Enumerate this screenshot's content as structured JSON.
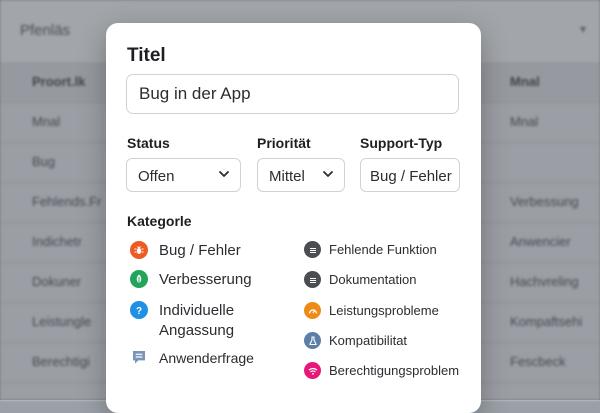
{
  "background": {
    "title": "Pfenläs",
    "header_cells": [
      "Proort.lk",
      "Mnal"
    ],
    "rows": [
      [
        "Mnal",
        "Mnal"
      ],
      [
        "Bug",
        ""
      ],
      [
        "Fehlends.Fr",
        "Verbessung"
      ],
      [
        "Indichetr",
        "Anwencier"
      ],
      [
        "Dokuner",
        "Hachvreling"
      ],
      [
        "Leistungle",
        "Kompaftsehi"
      ],
      [
        "Berechtigi",
        "Fescbeck"
      ]
    ]
  },
  "form": {
    "title_label": "Titel",
    "title_value": "Bug in der App",
    "status": {
      "label": "Status",
      "value": "Offen"
    },
    "priority": {
      "label": "Priorität",
      "value": "Mittel"
    },
    "support_type": {
      "label": "Support-Typ",
      "value": "Bug / Fehler"
    },
    "category_label": "Kategorle",
    "categories_left": [
      {
        "label": "Bug / Fehler",
        "icon": "bug-icon",
        "color": "#ee5a24"
      },
      {
        "label": "Verbesserung",
        "icon": "leaf-icon",
        "color": "#22a55a"
      },
      {
        "label": "Individuelle Angassung",
        "icon": "question-icon",
        "color": "#1e90e6"
      },
      {
        "label": "Anwenderfrage",
        "icon": "chat-icon",
        "color": "#7b95b8"
      }
    ],
    "categories_right": [
      {
        "label": "Fehlende Funktion",
        "icon": "list-icon",
        "color": "#4a4d52"
      },
      {
        "label": "Dokumentation",
        "icon": "list-icon",
        "color": "#4a4d52"
      },
      {
        "label": "Leistungsprobleme",
        "icon": "gauge-icon",
        "color": "#f08a17"
      },
      {
        "label": "Kompatibilitat",
        "icon": "flask-icon",
        "color": "#5b7fa6"
      },
      {
        "label": "Berechtigungsproblem",
        "icon": "wifi-icon",
        "color": "#e6197a"
      }
    ]
  }
}
